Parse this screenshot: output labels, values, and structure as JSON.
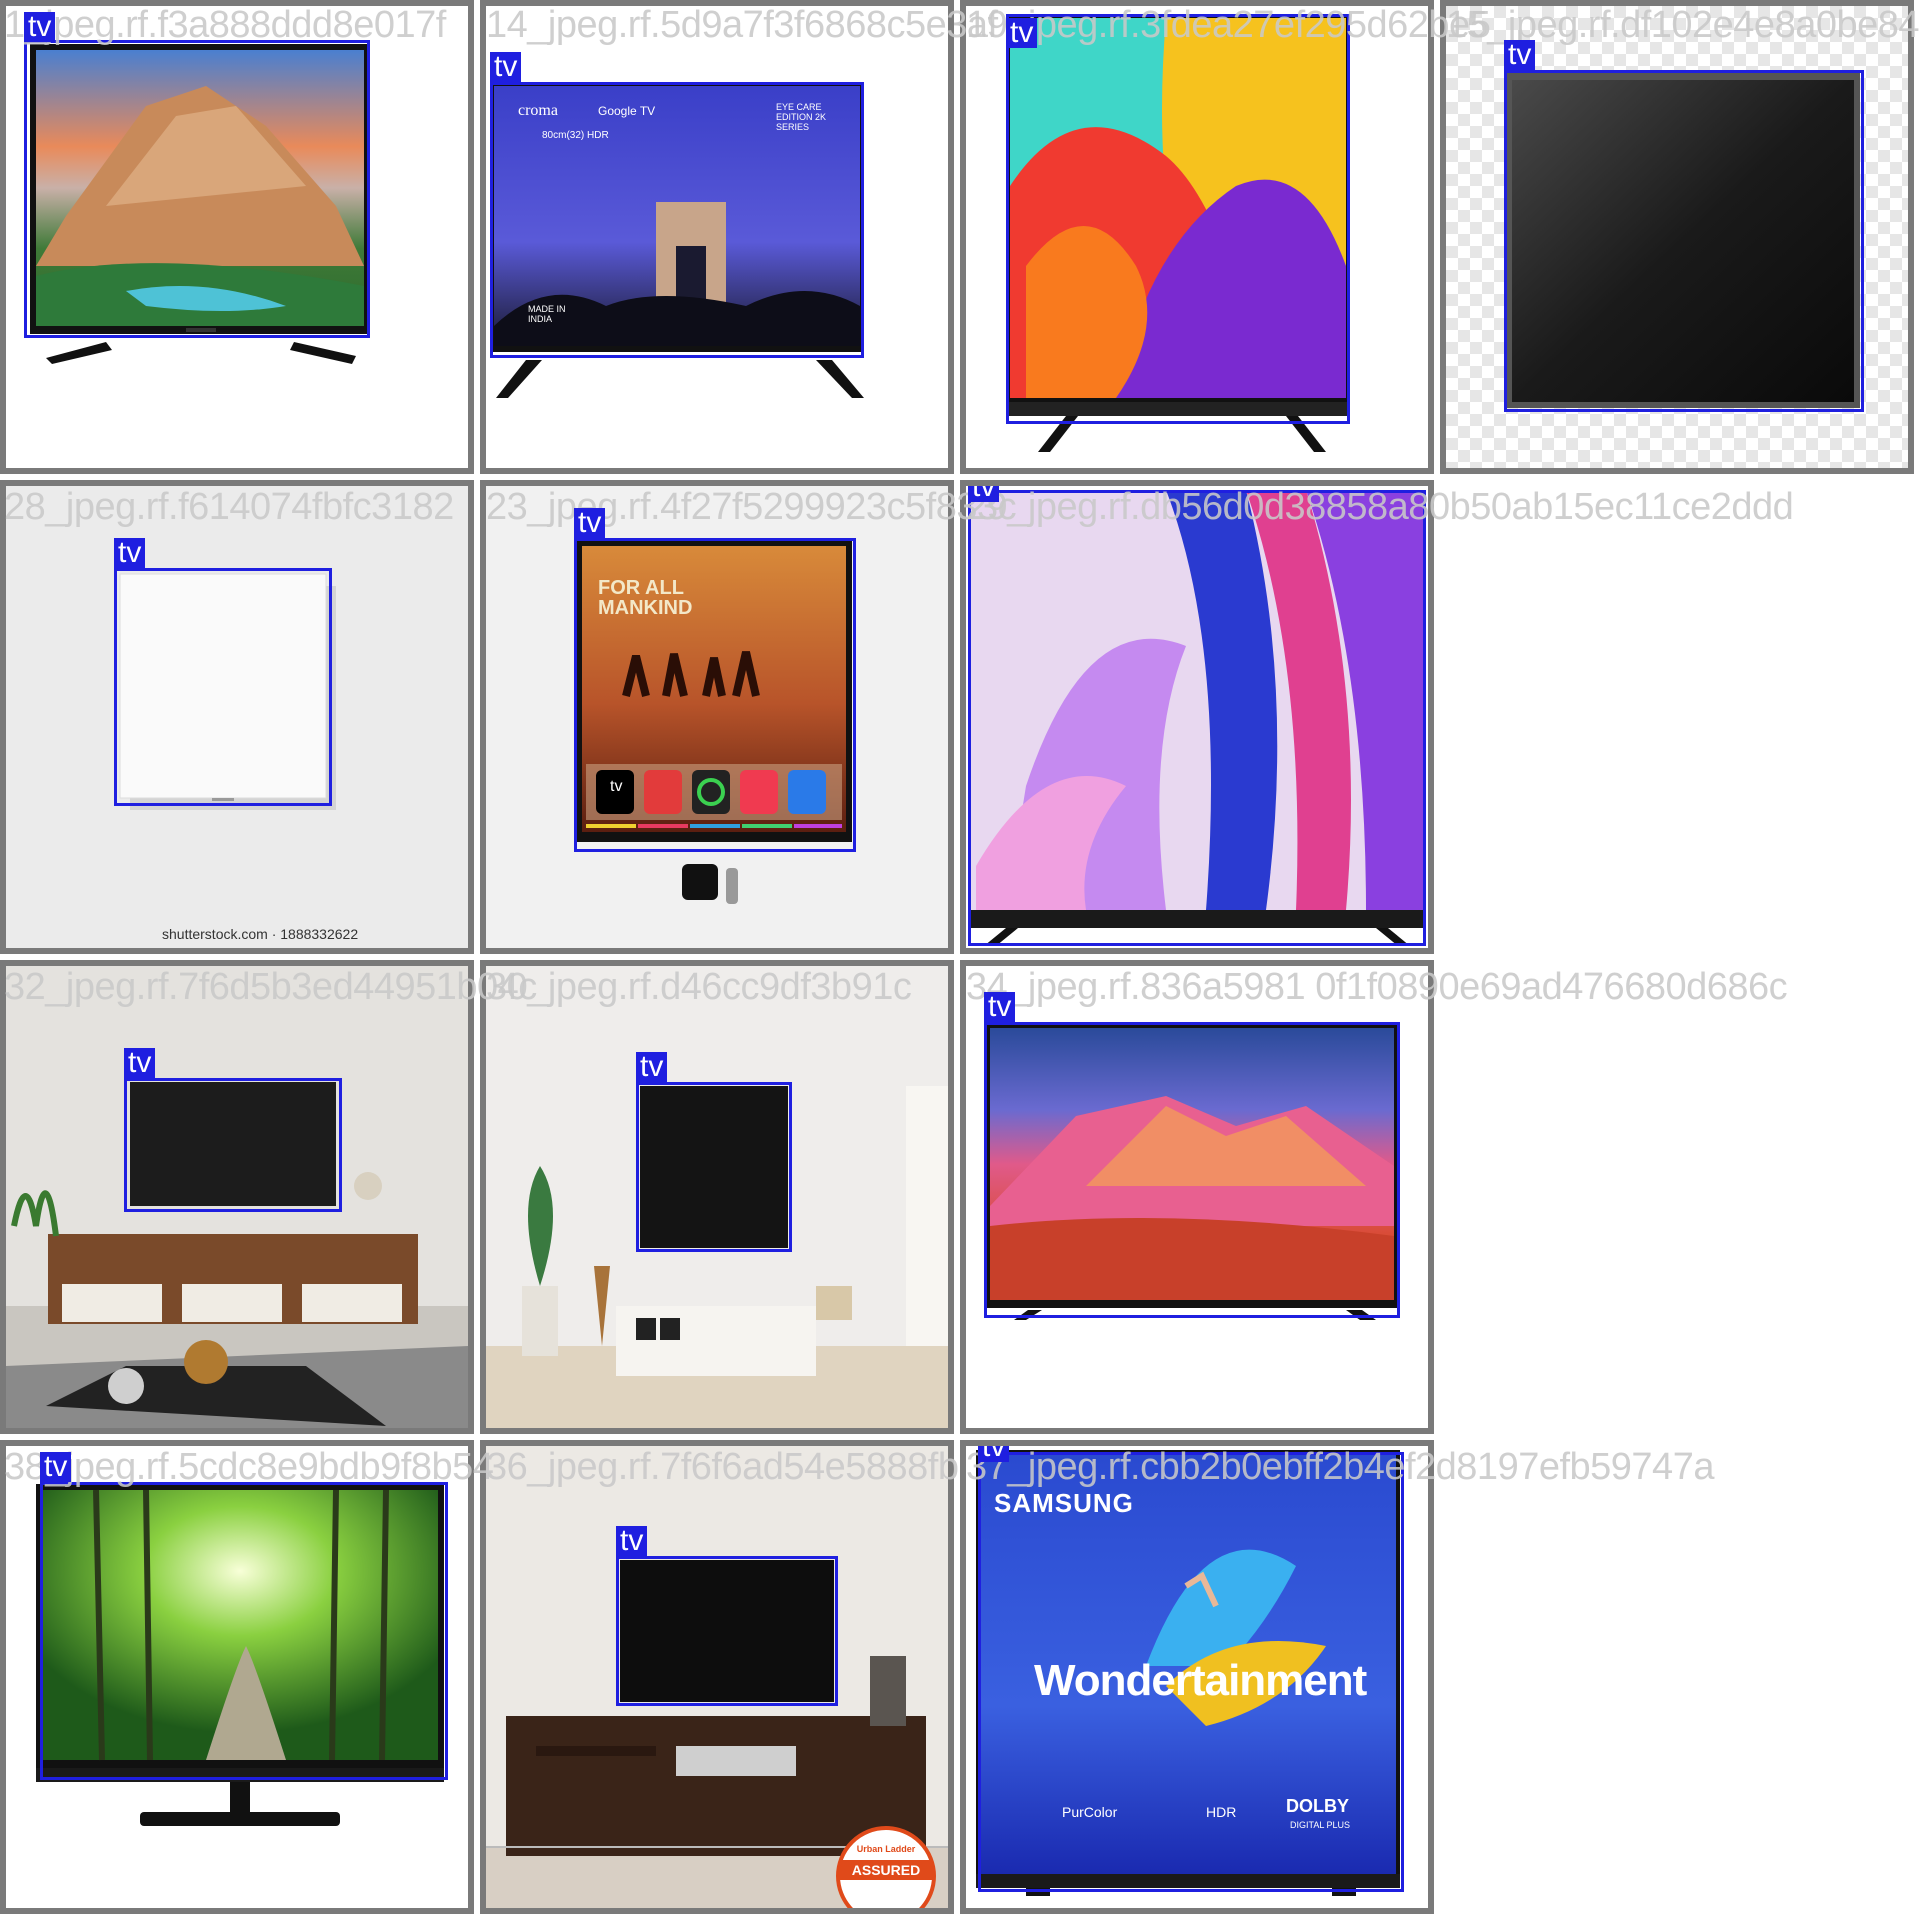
{
  "grid": {
    "tiles": [
      {
        "fname": "1_jpeg.rf.f3a888ddd8e017f",
        "label": "tv"
      },
      {
        "fname": "14_jpeg.rf.5d9a7f3f6868c5e3af",
        "label": "tv"
      },
      {
        "fname": "19_jpeg.rf.3fdea27ef295d62be5",
        "label": "tv"
      },
      {
        "fname": "15_jpeg.rf.df102e4e8a0be8409c",
        "label": "tv"
      },
      {
        "fname": "28_jpeg.rf.f614074fbfc3182",
        "label": "tv"
      },
      {
        "fname": "23_jpeg.rf.4f27f5299923c5f833c",
        "label": "tv"
      },
      {
        "fname": "29_jpeg.rf.db56d0d38858a80b50ab15ec11ce2ddd",
        "label": "tv"
      },
      {
        "fname": "32_jpeg.rf.7f6d5b3ed44951b04c",
        "label": "tv"
      },
      {
        "fname": "30_jpeg.rf.d46cc9df3b91c",
        "label": "tv"
      },
      {
        "fname": "34_jpeg.rf.836a5981 0f1f0890e69ad476680d686c",
        "label": "tv"
      },
      {
        "fname": "38_jpeg.rf.5cdc8e9bdb9f8b54",
        "label": "tv"
      },
      {
        "fname": "36_jpeg.rf.7f6f6ad54e5888fb",
        "label": "tv"
      },
      {
        "fname": "37_jpeg.rf.cbb2b0ebff2b4ef2d8197efb59747a",
        "label": "tv"
      }
    ]
  },
  "screen_text": {
    "croma_brand": "croma",
    "croma_sub": "Google TV",
    "croma_size": "80cm(32) HDR",
    "croma_edition": "EYE CARE EDITION 2K SERIES",
    "made_in_india": "MADE IN INDIA",
    "apple_headline": "FOR ALL MANKIND",
    "apple_tv": "tv",
    "shutterstock": "shutterstock.com · 1888332622",
    "samsung": "SAMSUNG",
    "wondertainment": "Wondertainment",
    "purcolor": "PurColor",
    "hdr": "HDR",
    "dolby": "DOLBY",
    "dolby_sub": "DIGITAL PLUS",
    "assured": "ASSURED",
    "urban_ladder": "Urban Ladder"
  }
}
